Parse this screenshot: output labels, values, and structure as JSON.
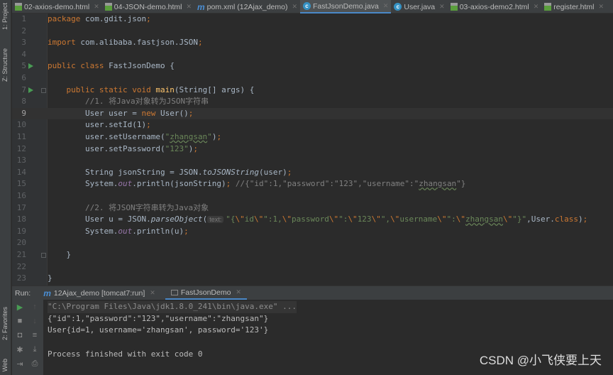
{
  "sidebar": {
    "project": "1: Project",
    "structure": "Z: Structure",
    "favorites": "2: Favorites",
    "web": "Web"
  },
  "tabs": [
    {
      "label": "02-axios-demo.html",
      "icon": "html-file-icon"
    },
    {
      "label": "04-JSON-demo.html",
      "icon": "html-file-icon"
    },
    {
      "label": "pom.xml (12Ajax_demo)",
      "icon": "maven-icon"
    },
    {
      "label": "FastJsonDemo.java",
      "icon": "java-class-icon",
      "active": true
    },
    {
      "label": "User.java",
      "icon": "java-class-icon"
    },
    {
      "label": "03-axios-demo2.html",
      "icon": "html-file-icon"
    },
    {
      "label": "register.html",
      "icon": "html-file-icon"
    }
  ],
  "editor": {
    "current_line": 9,
    "run_lines": [
      5,
      7
    ],
    "fold_lines": [
      7,
      21
    ],
    "lines": [
      [
        [
          "package",
          "kw"
        ],
        [
          " com.gdit.json",
          ""
        ],
        [
          ";",
          "kw"
        ]
      ],
      [],
      [
        [
          "import",
          "kw"
        ],
        [
          " com.alibaba.fastjson.JSON",
          ""
        ],
        [
          ";",
          "kw"
        ]
      ],
      [],
      [
        [
          "public class",
          "kw"
        ],
        [
          " FastJsonDemo {",
          ""
        ]
      ],
      [],
      [
        [
          "    "
        ],
        [
          "public static void",
          "kw"
        ],
        [
          " "
        ],
        [
          "main",
          "fn"
        ],
        [
          "(String[] args) {",
          ""
        ]
      ],
      [
        [
          "        "
        ],
        [
          "//1. 将Java对象转为JSON字符串",
          "cm"
        ]
      ],
      [
        [
          "        User user = "
        ],
        [
          "new",
          "kw"
        ],
        [
          " User()"
        ],
        [
          ";",
          "kw"
        ]
      ],
      [
        [
          "        user.setId(1)"
        ],
        [
          ";",
          "kw"
        ]
      ],
      [
        [
          "        user.setUsername("
        ],
        [
          "\"",
          "str"
        ],
        [
          "zhangsan",
          "str wv"
        ],
        [
          "\"",
          "str"
        ],
        [
          ")"
        ],
        [
          ";",
          "kw"
        ]
      ],
      [
        [
          "        user.setPassword("
        ],
        [
          "\"123\"",
          "str"
        ],
        [
          ")"
        ],
        [
          ";",
          "kw"
        ]
      ],
      [],
      [
        [
          "        String jsonString = JSON."
        ],
        [
          "toJSONString",
          "it"
        ],
        [
          "(user)"
        ],
        [
          ";",
          "kw"
        ]
      ],
      [
        [
          "        System."
        ],
        [
          "out",
          "st"
        ],
        [
          ".println(jsonString)"
        ],
        [
          ";",
          "kw"
        ],
        [
          " "
        ],
        [
          "//{\"id\":1,\"password\":\"123\",\"username\":\"",
          "cm"
        ],
        [
          "zhangsan",
          "cm wv"
        ],
        [
          "\"}",
          "cm"
        ]
      ],
      [],
      [
        [
          "        "
        ],
        [
          "//2. 将JSON字符串转为Java对象",
          "cm"
        ]
      ],
      [
        [
          "        User u = JSON."
        ],
        [
          "parseObject",
          "it"
        ],
        [
          "("
        ],
        [
          "text:",
          "hint"
        ],
        [
          "\"{",
          "str"
        ],
        [
          "\\\"",
          "kw"
        ],
        [
          "id",
          "str"
        ],
        [
          "\\\"",
          "kw"
        ],
        [
          "\":1,",
          "str"
        ],
        [
          "\\\"",
          "kw"
        ],
        [
          "password",
          "str"
        ],
        [
          "\\\"",
          "kw"
        ],
        [
          "\":",
          "str"
        ],
        [
          "\\\"",
          "kw"
        ],
        [
          "123",
          "str"
        ],
        [
          "\\\"",
          "kw"
        ],
        [
          "\",",
          "str"
        ],
        [
          "\\\"",
          "kw"
        ],
        [
          "username",
          "str"
        ],
        [
          "\\\"",
          "kw"
        ],
        [
          "\":",
          "str"
        ],
        [
          "\\\"",
          "kw"
        ],
        [
          "zhangsan",
          "str wv"
        ],
        [
          "\\\"",
          "kw"
        ],
        [
          "\"}\"",
          "str"
        ],
        [
          "",
          ""
        ],
        [
          ",User."
        ],
        [
          "class",
          "kw"
        ],
        [
          ")"
        ],
        [
          ";",
          "kw"
        ]
      ],
      [
        [
          "        System."
        ],
        [
          "out",
          "st"
        ],
        [
          ".println(u)"
        ],
        [
          ";",
          "kw"
        ]
      ],
      [],
      [
        [
          "    }"
        ]
      ],
      [],
      [
        [
          "}"
        ]
      ]
    ]
  },
  "run": {
    "label": "Run:",
    "tabs": [
      {
        "label": "12Ajax_demo [tomcat7:run]",
        "icon": "maven-icon"
      },
      {
        "label": "FastJsonDemo",
        "icon": "console-icon",
        "active": true
      }
    ],
    "console": [
      "\"C:\\Program Files\\Java\\jdk1.8.0_241\\bin\\java.exe\" ...",
      "{\"id\":1,\"password\":\"123\",\"username\":\"zhangsan\"}",
      "User{id=1, username='zhangsan', password='123'}",
      "",
      "Process finished with exit code 0"
    ]
  },
  "watermark": "CSDN @小飞侠要上天"
}
